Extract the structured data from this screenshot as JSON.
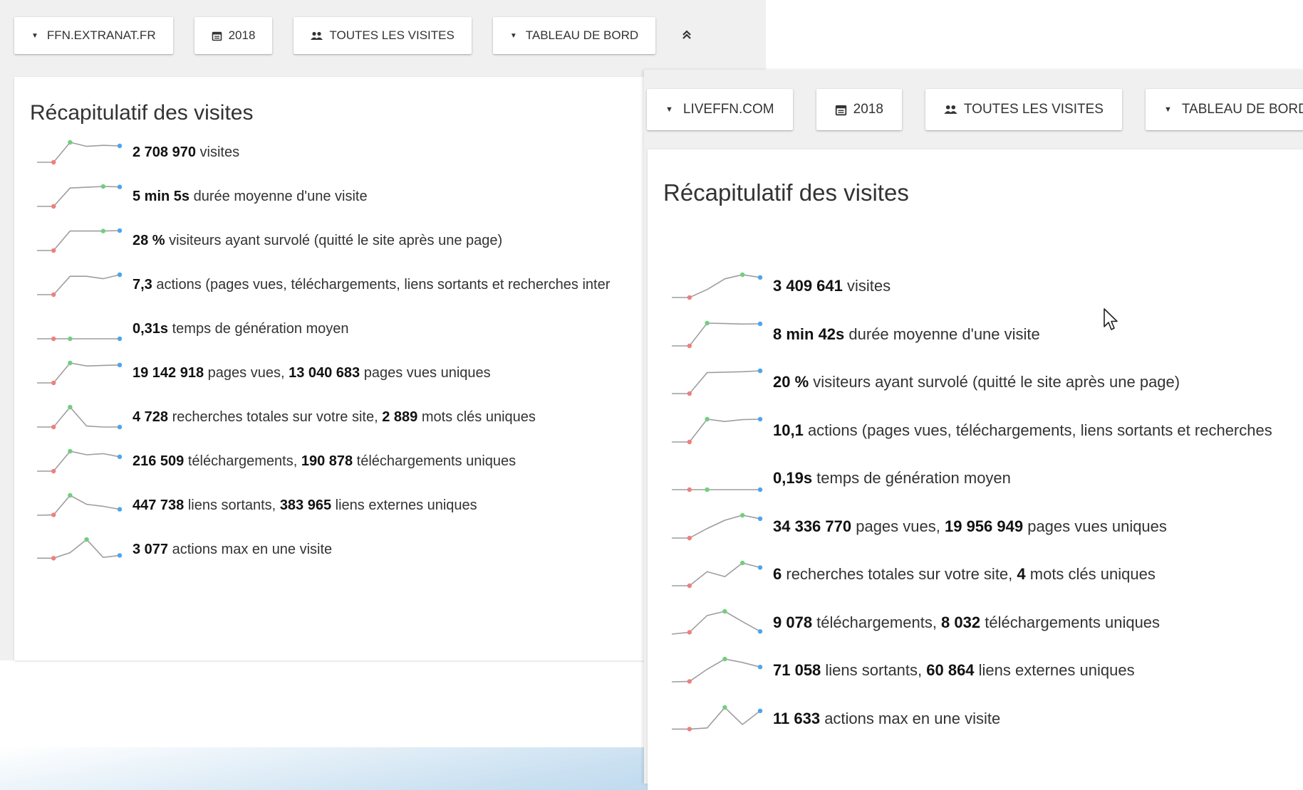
{
  "colors": {
    "line": "#9e9e9e",
    "start": "#ef7f7f",
    "max": "#6fcf7f",
    "end": "#4fa3f0"
  },
  "panels": [
    {
      "toolbar": {
        "site": "FFN.EXTRANAT.FR",
        "year": "2018",
        "segment": "TOUTES LES VISITES",
        "view": "TABLEAU DE BORD",
        "collapse_icon": "double-chevron-up-icon"
      },
      "title": "Récapitulatif des visites",
      "rows": [
        {
          "b1": "2 708 970",
          "t1": " visites",
          "b2": "",
          "t2": "",
          "spark": [
            0,
            0,
            1,
            0.8,
            0.85,
            0.82
          ],
          "maxi": 2
        },
        {
          "b1": "5 min 5s",
          "t1": " durée moyenne d'une visite",
          "b2": "",
          "t2": "",
          "spark": [
            0,
            0,
            0.92,
            0.96,
            1,
            0.98
          ],
          "maxi": 4
        },
        {
          "b1": "28 %",
          "t1": " visiteurs ayant survolé (quitté le site après une page)",
          "b2": "",
          "t2": "",
          "spark": [
            0,
            0,
            0.98,
            0.98,
            0.98,
            1
          ],
          "maxi": 4
        },
        {
          "b1": "7,3",
          "t1": " actions (pages vues, téléchargements, liens sortants et recherches inter",
          "b2": "",
          "t2": "",
          "spark": [
            0,
            0,
            0.92,
            0.92,
            0.8,
            1
          ],
          "maxi": 5
        },
        {
          "b1": "0,31s",
          "t1": " temps de génération moyen",
          "b2": "",
          "t2": "",
          "spark": [
            0,
            0,
            0,
            0,
            0,
            0
          ],
          "maxi": 2
        },
        {
          "b1": "19 142 918",
          "t1": " pages vues, ",
          "b2": "13 040 683",
          "t2": " pages vues uniques",
          "spark": [
            0,
            0,
            1,
            0.85,
            0.88,
            0.9
          ],
          "maxi": 2
        },
        {
          "b1": "4 728",
          "t1": " recherches totales sur votre site, ",
          "b2": "2 889",
          "t2": " mots clés uniques",
          "spark": [
            0,
            0,
            1,
            0.05,
            0,
            0
          ],
          "maxi": 2
        },
        {
          "b1": "216 509",
          "t1": " téléchargements, ",
          "b2": "190 878",
          "t2": " téléchargements uniques",
          "spark": [
            0,
            0,
            1,
            0.82,
            0.88,
            0.72
          ],
          "maxi": 2
        },
        {
          "b1": "447 738",
          "t1": " liens sortants, ",
          "b2": "383 965",
          "t2": " liens externes uniques",
          "spark": [
            0,
            0.02,
            1,
            0.55,
            0.45,
            0.3
          ],
          "maxi": 2
        },
        {
          "b1": "3 077",
          "t1": " actions max en une visite",
          "b2": "",
          "t2": "",
          "spark": [
            0.06,
            0.06,
            0.34,
            1,
            0.1,
            0.2
          ],
          "maxi": 3
        }
      ]
    },
    {
      "toolbar": {
        "site": "LIVEFFN.COM",
        "year": "2018",
        "segment": "TOUTES LES VISITES",
        "view": "TABLEAU DE BORD"
      },
      "title": "Récapitulatif des visites",
      "rows": [
        {
          "b1": "3 409 641",
          "t1": " visites",
          "b2": "",
          "t2": "",
          "spark": [
            0,
            0,
            0.35,
            0.82,
            1,
            0.88
          ],
          "maxi": 4
        },
        {
          "b1": "8 min 42s",
          "t1": " durée moyenne d'une visite",
          "b2": "",
          "t2": "",
          "spark": [
            0,
            0,
            1,
            0.98,
            0.96,
            0.97
          ],
          "maxi": 2
        },
        {
          "b1": "20 %",
          "t1": " visiteurs ayant survolé (quitté le site après une page)",
          "b2": "",
          "t2": "",
          "spark": [
            0,
            0,
            0.92,
            0.94,
            0.96,
            1
          ],
          "maxi": 5
        },
        {
          "b1": "10,1",
          "t1": " actions (pages vues, téléchargements, liens sortants et recherches",
          "b2": "",
          "t2": "",
          "spark": [
            0,
            0,
            1,
            0.9,
            0.98,
            1
          ],
          "maxi": 2
        },
        {
          "b1": "0,19s",
          "t1": " temps de génération moyen",
          "b2": "",
          "t2": "",
          "spark": [
            0,
            0,
            0,
            0,
            0,
            0
          ],
          "maxi": 2
        },
        {
          "b1": "34 336 770",
          "t1": " pages vues, ",
          "b2": "19 956 949",
          "t2": " pages vues uniques",
          "spark": [
            0,
            0,
            0.42,
            0.78,
            1,
            0.85
          ],
          "maxi": 4
        },
        {
          "b1": "6",
          "t1": " recherches totales sur votre site, ",
          "b2": "4",
          "t2": " mots clés uniques",
          "spark": [
            0,
            0,
            0.62,
            0.4,
            1,
            0.8
          ],
          "maxi": 4
        },
        {
          "b1": "9 078",
          "t1": " téléchargements, ",
          "b2": "8 032",
          "t2": " téléchargements uniques",
          "spark": [
            0,
            0.08,
            0.82,
            1,
            0.55,
            0.12
          ],
          "maxi": 3
        },
        {
          "b1": "71 058",
          "t1": " liens sortants, ",
          "b2": "60 864",
          "t2": " liens externes uniques",
          "spark": [
            0,
            0.02,
            0.55,
            1,
            0.85,
            0.65
          ],
          "maxi": 3
        },
        {
          "b1": "11 633",
          "t1": " actions max en une visite",
          "b2": "",
          "t2": "",
          "spark": [
            0.05,
            0.05,
            0.1,
            1,
            0.25,
            0.85
          ],
          "maxi": 3
        }
      ]
    }
  ]
}
